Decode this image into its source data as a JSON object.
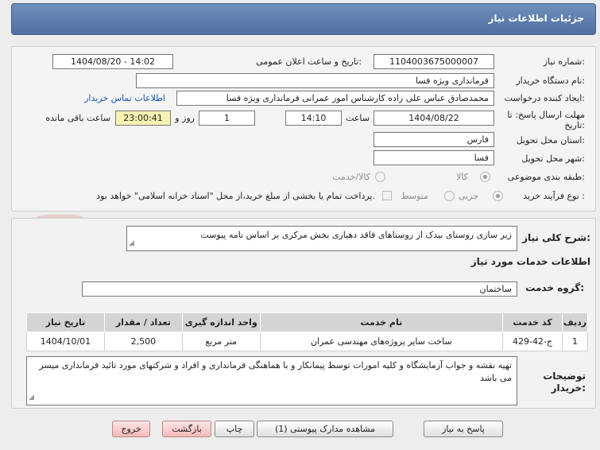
{
  "header": {
    "title": "جزئیات اطلاعات نیاز"
  },
  "form": {
    "need_number_label": "شماره نیاز:",
    "need_number": "1104003675000007",
    "announce_label": "تاریخ و ساعت اعلان عمومی:",
    "announce_value": "1404/08/20 - 14:02",
    "buyer_org_label": "نام دستگاه خریدار:",
    "buyer_org": "فرمانداری ویژه فسا",
    "requester_label": "ایجاد کننده درخواست:",
    "requester": "محمدصادق عباس علی زاده کارشناس امور عمرانی فرمانداری ویژه فسا",
    "contact_link": "اطلاعات تماس خریدار",
    "deadline_label_1": "مهلت ارسال پاسخ: تا",
    "deadline_label_2": "تاریخ:",
    "deadline_date": "1404/08/22",
    "time_label": "ساعت",
    "deadline_time": "14:10",
    "days_value": "1",
    "days_label": "روز و",
    "remaining_time": "23:00:41",
    "remaining_label": "ساعت باقی مانده",
    "province_label": "استان محل تحویل:",
    "province": "فارس",
    "city_label": "شهر محل تحویل:",
    "city": "فسا",
    "category_label": "طبقه بندی موضوعی:",
    "category_options": [
      "کالا",
      "کالا/خدمت"
    ],
    "purchase_type_label": "نوع فرآیند خرید :",
    "purchase_options": [
      "جزیی",
      "متوسط"
    ],
    "payment_note": "پرداخت تمام یا بخشی از مبلغ خرید،از محل \"اسناد خزانه اسلامی\" خواهد بود."
  },
  "summary": {
    "label": "شرح کلی نیاز:",
    "text": "زیر سازی روستای بیدک از روستاهای فاقد دهیاری بخش مرکزی بر اساس نامه پیوست"
  },
  "services": {
    "section_title": "اطلاعات خدمات مورد نیاز",
    "group_label": "گروه خدمت:",
    "group_value": "ساختمان",
    "columns": [
      "ردیف",
      "کد خدمت",
      "نام خدمت",
      "واحد اندازه گیری",
      "تعداد / مقدار",
      "تاریخ نیاز"
    ],
    "rows": [
      [
        "1",
        "ج-42-429",
        "ساخت سایر پروژه‌های مهندسی عمران",
        "متر مربع",
        "2,500",
        "1404/10/01"
      ]
    ]
  },
  "buyer_notes": {
    "label_1": "توضیحات",
    "label_2": "خریدار:",
    "text": "تهیه نقشه و جواب آزمایشگاه و کلیه امورات توسط پیمانکار و با هماهنگی فرمانداری و افراد و شرکتهای مورد تائید فرمانداری میسر می باشد"
  },
  "buttons": {
    "reply": "پاسخ به نیاز",
    "attachments": "مشاهده مدارک پیوستی (1)",
    "print": "چاپ",
    "back": "بازگشت",
    "exit": "خروج"
  },
  "watermark": {
    "text": "AriaTender.net"
  }
}
